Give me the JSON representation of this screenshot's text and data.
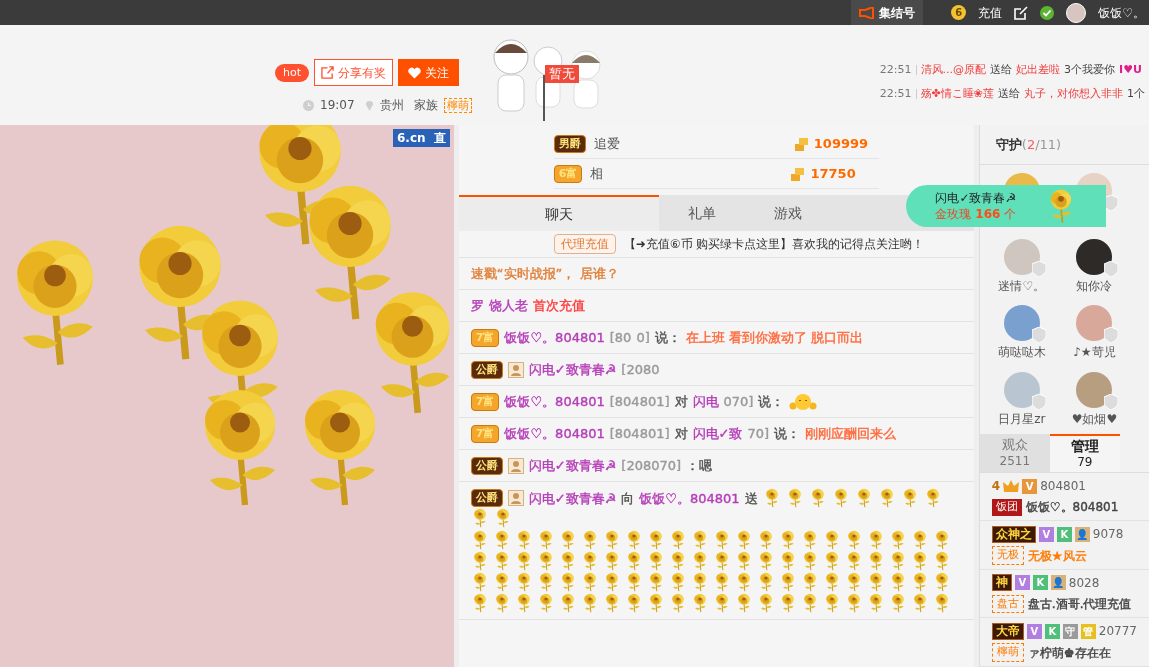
{
  "top_bar": {
    "rally_button": "集结号",
    "coin_level": "6",
    "recharge": "充值",
    "username": "饭饭♡。"
  },
  "header": {
    "hot_badge": "hot",
    "share_button": "分享有奖",
    "follow_button": "关注",
    "time": "19:07",
    "location": "贵州",
    "family_label": "家族",
    "family_tag": "檸萌",
    "flag": "暂无",
    "gift_feed": [
      {
        "time": "22:51",
        "sender": "清风...@原配",
        "verb": "送给",
        "receiver": "妃出差啦",
        "gift": "3个我爱你",
        "tag": "I♥U"
      },
      {
        "time": "22:51",
        "sender": "殇✤情こ睡❀莲",
        "verb": "送给",
        "receiver": "丸子，对你想入非非",
        "gift": "1个"
      }
    ]
  },
  "video": {
    "logo": "6.cn",
    "logo_suffix": "直"
  },
  "ranking": [
    {
      "badge": "男爵",
      "color": "#5a2a0c",
      "name": "追爱",
      "amount": "109999"
    },
    {
      "badge": "6富",
      "color": "#f4a52c",
      "name": "相",
      "amount": "17750"
    }
  ],
  "chat_tabs": [
    {
      "label": "聊天",
      "selected": true
    },
    {
      "label": "礼单",
      "selected": false
    },
    {
      "label": "游戏",
      "selected": false
    }
  ],
  "announcement": {
    "tag": "代理充值",
    "text": "【➜充值⑥币 购买绿卡点这里】喜欢我的记得点关注哟！"
  },
  "messages": [
    {
      "kind": "text",
      "parts": [
        {
          "color": "#e0803a",
          "text": "速戳“实时战报”，"
        },
        {
          "color": "#e0803a",
          "text": "居谁？"
        }
      ]
    },
    {
      "kind": "text",
      "parts": [
        {
          "color": "#b53db8",
          "text": "罗"
        },
        {
          "color": "#b53db8",
          "text": "饶人老"
        },
        {
          "color": "#ff3b3b",
          "text": "首次充值"
        }
      ]
    },
    {
      "kind": "text",
      "badge": {
        "label": "7富",
        "color": "#f4a52c"
      },
      "parts": [
        {
          "color": "#b53db8",
          "text": "饭饭♡。804801"
        },
        {
          "color": "#999999",
          "text": "[80"
        },
        {
          "color": "#999999",
          "text": "0]"
        },
        {
          "color": "#555555",
          "text": "说："
        },
        {
          "color": "#ff6a3d",
          "text": "在上班 看到你激动了 脱口而出"
        }
      ]
    },
    {
      "kind": "text",
      "badge": {
        "label": "公爵",
        "color": "#5a2a0c"
      },
      "user_icon": true,
      "parts": [
        {
          "color": "#b53db8",
          "text": "闪电✓致青春☭"
        },
        {
          "color": "#999999",
          "text": "[2080"
        }
      ]
    },
    {
      "kind": "text",
      "badge": {
        "label": "7富",
        "color": "#f4a52c"
      },
      "parts": [
        {
          "color": "#b53db8",
          "text": "饭饭♡。804801"
        },
        {
          "color": "#999999",
          "text": "[804801]"
        },
        {
          "color": "#555555",
          "text": "对"
        },
        {
          "color": "#b53db8",
          "text": "闪电"
        },
        {
          "color": "#999999",
          "text": "070]"
        },
        {
          "color": "#555555",
          "text": "说："
        }
      ],
      "emoji": true
    },
    {
      "kind": "text",
      "badge": {
        "label": "7富",
        "color": "#f4a52c"
      },
      "parts": [
        {
          "color": "#b53db8",
          "text": "饭饭♡。804801"
        },
        {
          "color": "#999999",
          "text": "[804801]"
        },
        {
          "color": "#555555",
          "text": "对"
        },
        {
          "color": "#b53db8",
          "text": "闪电✓致"
        },
        {
          "color": "#999999",
          "text": "70]"
        },
        {
          "color": "#555555",
          "text": "说："
        },
        {
          "color": "#ff6a3d",
          "text": "刚刚应酬回来么"
        }
      ]
    },
    {
      "kind": "text",
      "badge": {
        "label": "公爵",
        "color": "#5a2a0c"
      },
      "user_icon": true,
      "parts": [
        {
          "color": "#b53db8",
          "text": "闪电✓致青春☭"
        },
        {
          "color": "#999999",
          "text": "[208070]"
        },
        {
          "color": "#555555",
          "text": "：嗯"
        }
      ]
    },
    {
      "kind": "gift",
      "badge": {
        "label": "公爵",
        "color": "#5a2a0c"
      },
      "user_icon": true,
      "parts": [
        {
          "color": "#b53db8",
          "text": "闪电✓致青春☭"
        },
        {
          "color": "#555555",
          "text": "向"
        },
        {
          "color": "#b53db8",
          "text": "饭饭♡。804801"
        },
        {
          "color": "#555555",
          "text": "送"
        }
      ]
    }
  ],
  "gift_popup": {
    "sender": "闪电✓致青春☭",
    "gift": "金玫瑰",
    "count": "166",
    "unit": "个"
  },
  "guard": {
    "title": "守护",
    "open": "(",
    "count": "2",
    "total": "/11",
    "close": ")",
    "members": [
      {
        "color": "#e9b949"
      },
      {
        "color": "#e8d2c4"
      },
      {
        "color": "#cfc6c0",
        "name": "迷情♡。"
      },
      {
        "color": "#2d2a28",
        "name": "知你冷"
      },
      {
        "color": "#7aa0d0",
        "name": "萌哒哒木"
      },
      {
        "color": "#d8a89a",
        "name": "♪★苛児"
      },
      {
        "color": "#b9c6d2",
        "name": "日月星zr"
      },
      {
        "color": "#b89e80",
        "name": "♥如烟♥"
      }
    ]
  },
  "audience_tabs": [
    {
      "label": "观众",
      "count": "2511",
      "selected": false
    },
    {
      "label": "管理",
      "count": "79",
      "selected": true
    }
  ],
  "admins": [
    {
      "level": "4",
      "crown": true,
      "badges": [
        {
          "label": "V",
          "color": "#e8963c"
        }
      ],
      "id": "804801",
      "tag": {
        "text": "饭团",
        "kind": "fan",
        "color": "#b01818"
      },
      "name": {
        "text": "饭饭♡。804801",
        "color": "#444444"
      }
    },
    {
      "title": "众神之",
      "badges": [
        {
          "label": "V",
          "color": "#b07fe0"
        },
        {
          "label": "K",
          "color": "#4fbf7a"
        },
        {
          "label": "👤",
          "color": "#d9b27a"
        }
      ],
      "id": "9078",
      "tag": {
        "text": "无极",
        "kind": "family",
        "color": "#ff7a00"
      },
      "name": {
        "text": "无极★风云",
        "color": "#ff7a00"
      }
    },
    {
      "title": "神",
      "badges": [
        {
          "label": "V",
          "color": "#b07fe0"
        },
        {
          "label": "K",
          "color": "#4fbf7a"
        },
        {
          "label": "👤",
          "color": "#d9b27a"
        }
      ],
      "id": "8028",
      "tag": {
        "text": "盘古",
        "kind": "family",
        "color": "#ff7a00"
      },
      "name": {
        "text": "盘古.酒哥.代理充值",
        "color": "#444444"
      }
    },
    {
      "title": "大帝",
      "badges": [
        {
          "label": "V",
          "color": "#b07fe0"
        },
        {
          "label": "K",
          "color": "#4fbf7a"
        },
        {
          "label": "守",
          "color": "#9a9a9a"
        },
        {
          "label": "管",
          "color": "#e6c01e"
        }
      ],
      "id": "20777",
      "tag": {
        "text": "檸萌",
        "kind": "family",
        "color": "#ff7a00"
      },
      "name": {
        "text": "ァ柠萌♚存在在",
        "color": "#444444"
      }
    }
  ]
}
